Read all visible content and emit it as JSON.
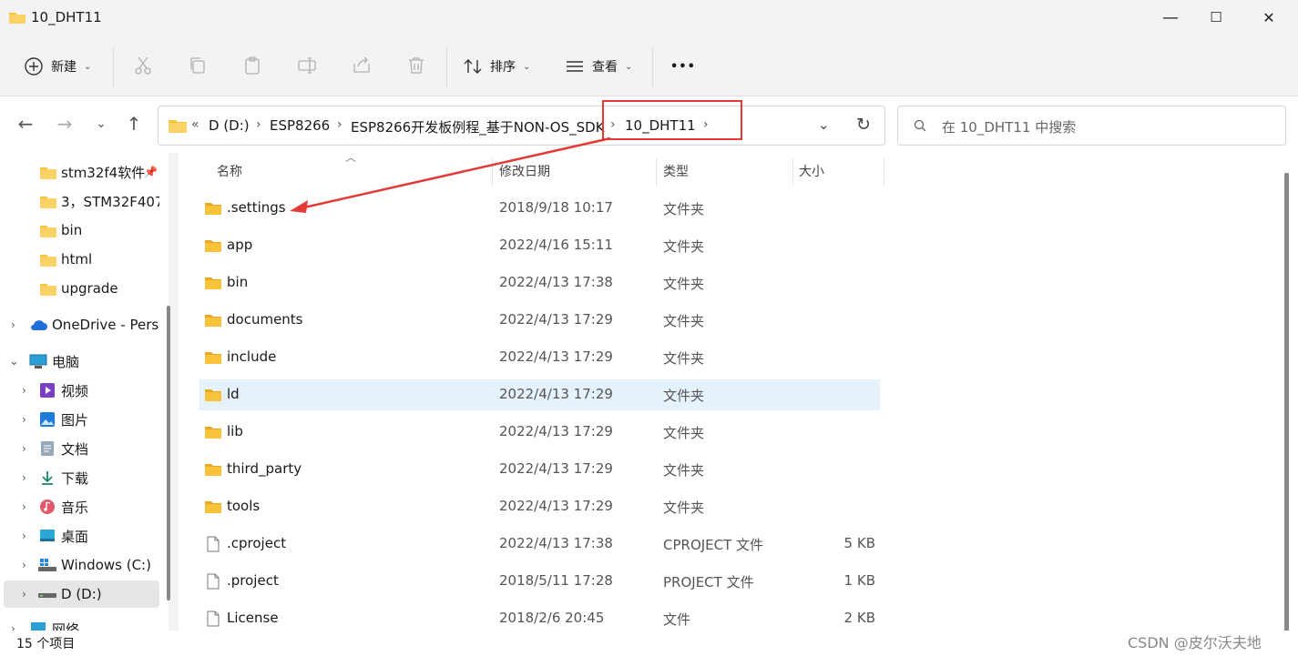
{
  "window": {
    "title": "10_DHT11"
  },
  "window_buttons": {
    "minimize": "—",
    "maximize": "☐",
    "close": "✕"
  },
  "toolbar": {
    "new_label": "新建",
    "sort_label": "排序",
    "view_label": "查看",
    "more_label": "•••"
  },
  "address": {
    "prefix": "«",
    "crumbs": [
      "D (D:)",
      "ESP8266",
      "ESP8266开发板例程_基于NON-OS_SDK",
      "10_DHT11"
    ],
    "chevron": "›"
  },
  "search": {
    "placeholder": "在 10_DHT11 中搜索"
  },
  "sidebar": {
    "quick": [
      "stm32f4软件",
      "3，STM32F407",
      "bin",
      "html",
      "upgrade"
    ],
    "onedrive": "OneDrive - Perso",
    "pc": "电脑",
    "pc_items": [
      "视频",
      "图片",
      "文档",
      "下载",
      "音乐",
      "桌面",
      "Windows (C:)",
      "D (D:)"
    ],
    "network": "网络"
  },
  "columns": {
    "name": "名称",
    "date": "修改日期",
    "type": "类型",
    "size": "大小"
  },
  "files": [
    {
      "name": ".settings",
      "date": "2018/9/18 10:17",
      "type": "文件夹",
      "size": "",
      "icon": "folder-icon"
    },
    {
      "name": "app",
      "date": "2022/4/16 15:11",
      "type": "文件夹",
      "size": "",
      "icon": "folder-icon"
    },
    {
      "name": "bin",
      "date": "2022/4/13 17:38",
      "type": "文件夹",
      "size": "",
      "icon": "folder-icon"
    },
    {
      "name": "documents",
      "date": "2022/4/13 17:29",
      "type": "文件夹",
      "size": "",
      "icon": "folder-icon"
    },
    {
      "name": "include",
      "date": "2022/4/13 17:29",
      "type": "文件夹",
      "size": "",
      "icon": "folder-icon"
    },
    {
      "name": "ld",
      "date": "2022/4/13 17:29",
      "type": "文件夹",
      "size": "",
      "icon": "folder-icon"
    },
    {
      "name": "lib",
      "date": "2022/4/13 17:29",
      "type": "文件夹",
      "size": "",
      "icon": "folder-icon"
    },
    {
      "name": "third_party",
      "date": "2022/4/13 17:29",
      "type": "文件夹",
      "size": "",
      "icon": "folder-icon"
    },
    {
      "name": "tools",
      "date": "2022/4/13 17:29",
      "type": "文件夹",
      "size": "",
      "icon": "folder-icon"
    },
    {
      "name": ".cproject",
      "date": "2022/4/13 17:38",
      "type": "CPROJECT 文件",
      "size": "5 KB",
      "icon": "file-icon"
    },
    {
      "name": ".project",
      "date": "2018/5/11 17:28",
      "type": "PROJECT 文件",
      "size": "1 KB",
      "icon": "file-icon"
    },
    {
      "name": "License",
      "date": "2018/2/6 20:45",
      "type": "文件",
      "size": "2 KB",
      "icon": "file-icon"
    }
  ],
  "status": {
    "count": "15 个项目"
  },
  "watermark": "CSDN @皮尔沃夫地",
  "colors": {
    "folder": "#f8c33a",
    "highlight": "#e5f1fb",
    "annotation": "#e53935"
  }
}
